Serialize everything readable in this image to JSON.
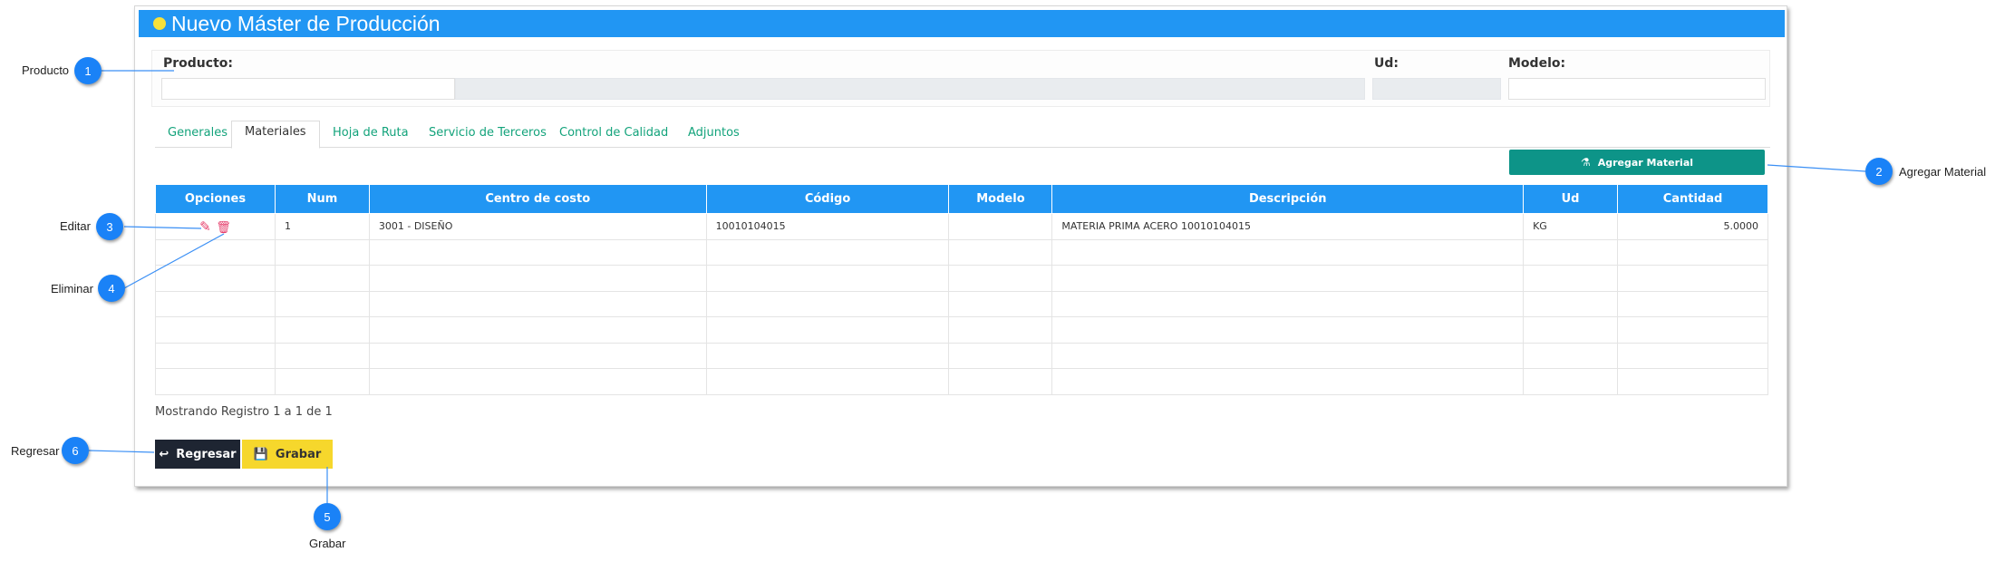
{
  "title": "Nuevo Máster de Producción",
  "colors": {
    "primary": "#2196f3",
    "teal": "#0d9488",
    "dark": "#1e2532",
    "yellow": "#f6d72c",
    "callout": "#1a82f7"
  },
  "product_section": {
    "producto_label": "Producto:",
    "ud_label": "Ud:",
    "modelo_label": "Modelo:"
  },
  "tabs": [
    "Generales",
    "Materiales",
    "Hoja de Ruta",
    "Servicio de Terceros",
    "Control de Calidad",
    "Adjuntos"
  ],
  "active_tab": "Materiales",
  "agregar_button": {
    "label": "Agregar Material",
    "icon": "flask-icon"
  },
  "table": {
    "headers": [
      "Opciones",
      "Num",
      "Centro de costo",
      "Código",
      "Modelo",
      "Descripción",
      "Ud",
      "Cantidad"
    ],
    "rows": [
      {
        "num": "1",
        "centro": "3001 - DISEÑO",
        "codigo": "10010104015",
        "modelo": "",
        "descripcion": "MATERIA PRIMA ACERO 10010104015",
        "ud": "KG",
        "cantidad": "5.0000"
      }
    ],
    "empty_rows": 6
  },
  "footer_text": "Mostrando Registro 1 a 1 de 1",
  "buttons": {
    "regresar": "Regresar",
    "grabar": "Grabar"
  },
  "callouts": [
    {
      "n": "1",
      "label": "Producto"
    },
    {
      "n": "2",
      "label": "Agregar Material"
    },
    {
      "n": "3",
      "label": "Editar"
    },
    {
      "n": "4",
      "label": "Eliminar"
    },
    {
      "n": "5",
      "label": "Grabar"
    },
    {
      "n": "6",
      "label": "Regresar"
    }
  ]
}
